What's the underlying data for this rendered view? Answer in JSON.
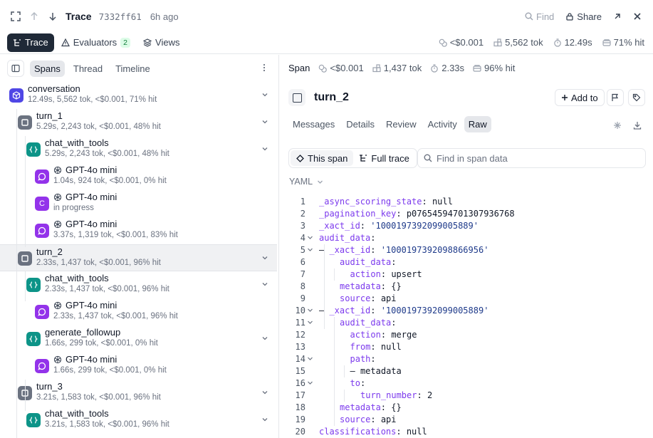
{
  "topbar": {
    "title": "Trace",
    "trace_id": "7332ff61",
    "time_ago": "6h ago",
    "find_label": "Find",
    "share_label": "Share"
  },
  "tabs": [
    {
      "label": "Trace",
      "active": true
    },
    {
      "label": "Evaluators",
      "badge": "2",
      "active": false
    },
    {
      "label": "Views",
      "active": false
    }
  ],
  "summary": {
    "cost": "<$0.001",
    "tokens": "5,562 tok",
    "duration": "12.49s",
    "cache_hit": "71% hit"
  },
  "left": {
    "view_tabs": [
      {
        "label": "Spans",
        "active": true
      },
      {
        "label": "Thread",
        "active": false
      },
      {
        "label": "Timeline",
        "active": false
      }
    ],
    "spans": [
      {
        "name": "conversation",
        "meta": "12.49s, 5,562 tok, <$0.001, 71% hit",
        "icon": "cube-icon",
        "color": "blue",
        "depth": 0,
        "model": false,
        "chevron": true,
        "selected": false
      },
      {
        "name": "turn_1",
        "meta": "5.29s, 2,243 tok, <$0.001, 48% hit",
        "icon": "square-icon",
        "color": "gray",
        "depth": 1,
        "model": false,
        "chevron": true,
        "selected": false
      },
      {
        "name": "chat_with_tools",
        "meta": "5.29s, 2,243 tok, <$0.001, 48% hit",
        "icon": "braces-icon",
        "color": "teal",
        "depth": 2,
        "model": false,
        "chevron": true,
        "selected": false
      },
      {
        "name": "GPT-4o mini",
        "meta": "1.04s, 924 tok, <$0.001, 0% hit",
        "icon": "message-icon",
        "color": "purple",
        "depth": 3,
        "model": true,
        "chevron": false,
        "selected": false
      },
      {
        "name": "GPT-4o mini",
        "meta": "in progress",
        "icon": "c-icon",
        "color": "purple",
        "depth": 3,
        "model": true,
        "chevron": false,
        "selected": false
      },
      {
        "name": "GPT-4o mini",
        "meta": "3.37s, 1,319 tok, <$0.001, 83% hit",
        "icon": "message-icon",
        "color": "purple",
        "depth": 3,
        "model": true,
        "chevron": false,
        "selected": false
      },
      {
        "name": "turn_2",
        "meta": "2.33s, 1,437 tok, <$0.001, 96% hit",
        "icon": "square-icon",
        "color": "gray",
        "depth": 1,
        "model": false,
        "chevron": true,
        "selected": true
      },
      {
        "name": "chat_with_tools",
        "meta": "2.33s, 1,437 tok, <$0.001, 96% hit",
        "icon": "braces-icon",
        "color": "teal",
        "depth": 2,
        "model": false,
        "chevron": true,
        "selected": false
      },
      {
        "name": "GPT-4o mini",
        "meta": "2.33s, 1,437 tok, <$0.001, 96% hit",
        "icon": "message-icon",
        "color": "purple",
        "depth": 3,
        "model": true,
        "chevron": false,
        "selected": false
      },
      {
        "name": "generate_followup",
        "meta": "1.66s, 299 tok, <$0.001, 0% hit",
        "icon": "braces-icon",
        "color": "teal",
        "depth": 2,
        "model": false,
        "chevron": true,
        "selected": false
      },
      {
        "name": "GPT-4o mini",
        "meta": "1.66s, 299 tok, <$0.001, 0% hit",
        "icon": "message-icon",
        "color": "purple",
        "depth": 3,
        "model": true,
        "chevron": false,
        "selected": false
      },
      {
        "name": "turn_3",
        "meta": "3.21s, 1,583 tok, <$0.001, 96% hit",
        "icon": "square-icon",
        "color": "gray",
        "depth": 1,
        "model": false,
        "chevron": true,
        "selected": false
      },
      {
        "name": "chat_with_tools",
        "meta": "3.21s, 1,583 tok, <$0.001, 96% hit",
        "icon": "braces-icon",
        "color": "teal",
        "depth": 2,
        "model": false,
        "chevron": true,
        "selected": false
      }
    ]
  },
  "span": {
    "type_label": "Span",
    "cost": "<$0.001",
    "tokens": "1,437 tok",
    "duration": "2.33s",
    "cache_hit": "96% hit",
    "title": "turn_2",
    "add_to_label": "Add to",
    "tabs": [
      {
        "label": "Messages",
        "active": false
      },
      {
        "label": "Details",
        "active": false
      },
      {
        "label": "Review",
        "active": false
      },
      {
        "label": "Activity",
        "active": false
      },
      {
        "label": "Raw",
        "active": true
      }
    ],
    "scope": [
      {
        "label": "This span",
        "active": true
      },
      {
        "label": "Full trace",
        "active": false
      }
    ],
    "search_placeholder": "Find in span data",
    "format_label": "YAML"
  },
  "code_lines": [
    {
      "n": "1",
      "indent": 0,
      "fold": false,
      "dash": false,
      "key": "_async_scoring_state",
      "val": "null",
      "quoted": false
    },
    {
      "n": "2",
      "indent": 0,
      "fold": false,
      "dash": false,
      "key": "_pagination_key",
      "val": "p07654594701307936768",
      "quoted": false
    },
    {
      "n": "3",
      "indent": 0,
      "fold": false,
      "dash": false,
      "key": "_xact_id",
      "val": "'1000197392099005889'",
      "quoted": true
    },
    {
      "n": "4",
      "indent": 0,
      "fold": true,
      "dash": false,
      "key": "audit_data",
      "val": "",
      "quoted": false
    },
    {
      "n": "5",
      "indent": 1,
      "fold": true,
      "dash": true,
      "key": "_xact_id",
      "val": "'1000197392098866956'",
      "quoted": true
    },
    {
      "n": "6",
      "indent": 2,
      "fold": false,
      "dash": false,
      "key": "audit_data",
      "val": "",
      "quoted": false
    },
    {
      "n": "7",
      "indent": 3,
      "fold": false,
      "dash": false,
      "key": "action",
      "val": "upsert",
      "quoted": false
    },
    {
      "n": "8",
      "indent": 2,
      "fold": false,
      "dash": false,
      "key": "metadata",
      "val": "{}",
      "quoted": false
    },
    {
      "n": "9",
      "indent": 2,
      "fold": false,
      "dash": false,
      "key": "source",
      "val": "api",
      "quoted": false
    },
    {
      "n": "10",
      "indent": 1,
      "fold": true,
      "dash": true,
      "key": "_xact_id",
      "val": "'1000197392099005889'",
      "quoted": true
    },
    {
      "n": "11",
      "indent": 2,
      "fold": true,
      "dash": false,
      "key": "audit_data",
      "val": "",
      "quoted": false
    },
    {
      "n": "12",
      "indent": 3,
      "fold": false,
      "dash": false,
      "key": "action",
      "val": "merge",
      "quoted": false
    },
    {
      "n": "13",
      "indent": 3,
      "fold": false,
      "dash": false,
      "key": "from",
      "val": "null",
      "quoted": false
    },
    {
      "n": "14",
      "indent": 3,
      "fold": true,
      "dash": false,
      "key": "path",
      "val": "",
      "quoted": false
    },
    {
      "n": "15",
      "indent": 4,
      "fold": false,
      "dash": true,
      "key": "",
      "val": "metadata",
      "quoted": false
    },
    {
      "n": "16",
      "indent": 3,
      "fold": true,
      "dash": false,
      "key": "to",
      "val": "",
      "quoted": false
    },
    {
      "n": "17",
      "indent": 4,
      "fold": false,
      "dash": false,
      "key": "turn_number",
      "val": "2",
      "quoted": false
    },
    {
      "n": "18",
      "indent": 2,
      "fold": false,
      "dash": false,
      "key": "metadata",
      "val": "{}",
      "quoted": false
    },
    {
      "n": "19",
      "indent": 2,
      "fold": false,
      "dash": false,
      "key": "source",
      "val": "api",
      "quoted": false
    },
    {
      "n": "20",
      "indent": 0,
      "fold": false,
      "dash": false,
      "key": "classifications",
      "val": "null",
      "quoted": false
    }
  ],
  "colors": {
    "accent_dark": "#1f2937",
    "span_blue": "#4f46e5",
    "span_gray": "#6b7280",
    "span_teal": "#0d9488",
    "span_purple": "#9333ea",
    "yaml_key": "#7c3aed",
    "yaml_string": "#1e3a8a"
  }
}
